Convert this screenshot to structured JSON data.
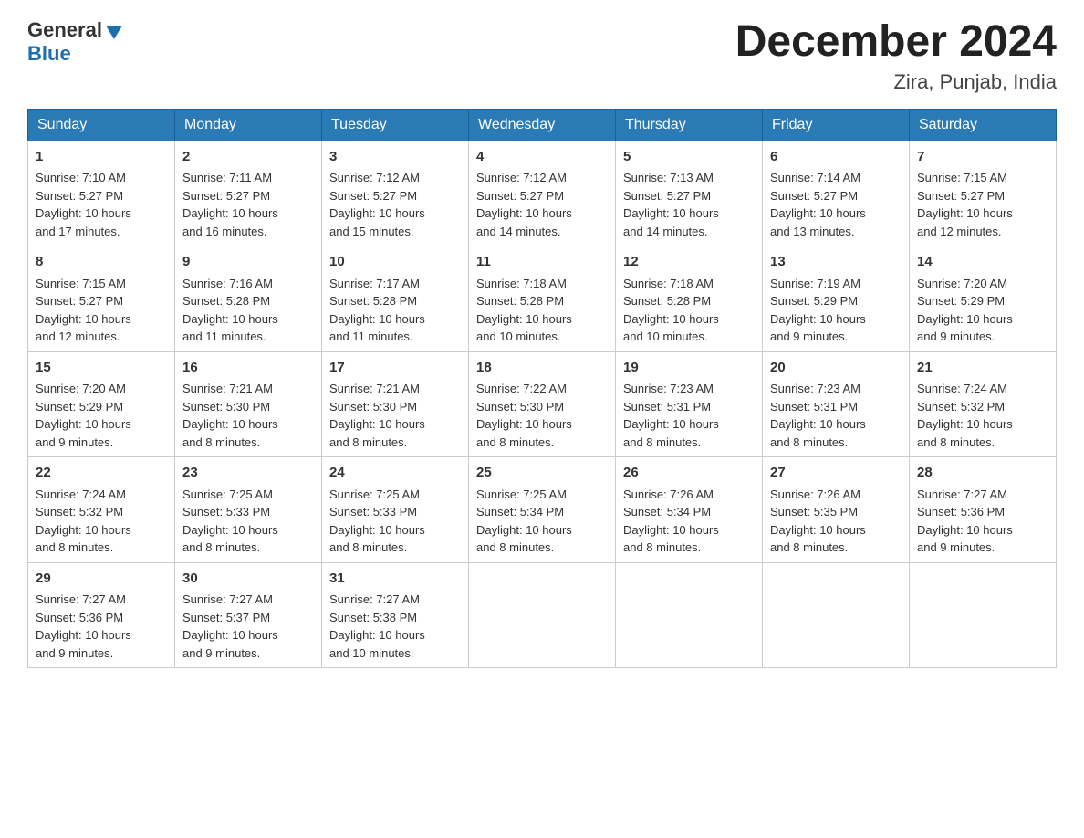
{
  "header": {
    "logo_general": "General",
    "logo_blue": "Blue",
    "month_title": "December 2024",
    "location": "Zira, Punjab, India"
  },
  "days_of_week": [
    "Sunday",
    "Monday",
    "Tuesday",
    "Wednesday",
    "Thursday",
    "Friday",
    "Saturday"
  ],
  "weeks": [
    [
      {
        "day": "1",
        "sunrise": "7:10 AM",
        "sunset": "5:27 PM",
        "daylight": "10 hours and 17 minutes."
      },
      {
        "day": "2",
        "sunrise": "7:11 AM",
        "sunset": "5:27 PM",
        "daylight": "10 hours and 16 minutes."
      },
      {
        "day": "3",
        "sunrise": "7:12 AM",
        "sunset": "5:27 PM",
        "daylight": "10 hours and 15 minutes."
      },
      {
        "day": "4",
        "sunrise": "7:12 AM",
        "sunset": "5:27 PM",
        "daylight": "10 hours and 14 minutes."
      },
      {
        "day": "5",
        "sunrise": "7:13 AM",
        "sunset": "5:27 PM",
        "daylight": "10 hours and 14 minutes."
      },
      {
        "day": "6",
        "sunrise": "7:14 AM",
        "sunset": "5:27 PM",
        "daylight": "10 hours and 13 minutes."
      },
      {
        "day": "7",
        "sunrise": "7:15 AM",
        "sunset": "5:27 PM",
        "daylight": "10 hours and 12 minutes."
      }
    ],
    [
      {
        "day": "8",
        "sunrise": "7:15 AM",
        "sunset": "5:27 PM",
        "daylight": "10 hours and 12 minutes."
      },
      {
        "day": "9",
        "sunrise": "7:16 AM",
        "sunset": "5:28 PM",
        "daylight": "10 hours and 11 minutes."
      },
      {
        "day": "10",
        "sunrise": "7:17 AM",
        "sunset": "5:28 PM",
        "daylight": "10 hours and 11 minutes."
      },
      {
        "day": "11",
        "sunrise": "7:18 AM",
        "sunset": "5:28 PM",
        "daylight": "10 hours and 10 minutes."
      },
      {
        "day": "12",
        "sunrise": "7:18 AM",
        "sunset": "5:28 PM",
        "daylight": "10 hours and 10 minutes."
      },
      {
        "day": "13",
        "sunrise": "7:19 AM",
        "sunset": "5:29 PM",
        "daylight": "10 hours and 9 minutes."
      },
      {
        "day": "14",
        "sunrise": "7:20 AM",
        "sunset": "5:29 PM",
        "daylight": "10 hours and 9 minutes."
      }
    ],
    [
      {
        "day": "15",
        "sunrise": "7:20 AM",
        "sunset": "5:29 PM",
        "daylight": "10 hours and 9 minutes."
      },
      {
        "day": "16",
        "sunrise": "7:21 AM",
        "sunset": "5:30 PM",
        "daylight": "10 hours and 8 minutes."
      },
      {
        "day": "17",
        "sunrise": "7:21 AM",
        "sunset": "5:30 PM",
        "daylight": "10 hours and 8 minutes."
      },
      {
        "day": "18",
        "sunrise": "7:22 AM",
        "sunset": "5:30 PM",
        "daylight": "10 hours and 8 minutes."
      },
      {
        "day": "19",
        "sunrise": "7:23 AM",
        "sunset": "5:31 PM",
        "daylight": "10 hours and 8 minutes."
      },
      {
        "day": "20",
        "sunrise": "7:23 AM",
        "sunset": "5:31 PM",
        "daylight": "10 hours and 8 minutes."
      },
      {
        "day": "21",
        "sunrise": "7:24 AM",
        "sunset": "5:32 PM",
        "daylight": "10 hours and 8 minutes."
      }
    ],
    [
      {
        "day": "22",
        "sunrise": "7:24 AM",
        "sunset": "5:32 PM",
        "daylight": "10 hours and 8 minutes."
      },
      {
        "day": "23",
        "sunrise": "7:25 AM",
        "sunset": "5:33 PM",
        "daylight": "10 hours and 8 minutes."
      },
      {
        "day": "24",
        "sunrise": "7:25 AM",
        "sunset": "5:33 PM",
        "daylight": "10 hours and 8 minutes."
      },
      {
        "day": "25",
        "sunrise": "7:25 AM",
        "sunset": "5:34 PM",
        "daylight": "10 hours and 8 minutes."
      },
      {
        "day": "26",
        "sunrise": "7:26 AM",
        "sunset": "5:34 PM",
        "daylight": "10 hours and 8 minutes."
      },
      {
        "day": "27",
        "sunrise": "7:26 AM",
        "sunset": "5:35 PM",
        "daylight": "10 hours and 8 minutes."
      },
      {
        "day": "28",
        "sunrise": "7:27 AM",
        "sunset": "5:36 PM",
        "daylight": "10 hours and 9 minutes."
      }
    ],
    [
      {
        "day": "29",
        "sunrise": "7:27 AM",
        "sunset": "5:36 PM",
        "daylight": "10 hours and 9 minutes."
      },
      {
        "day": "30",
        "sunrise": "7:27 AM",
        "sunset": "5:37 PM",
        "daylight": "10 hours and 9 minutes."
      },
      {
        "day": "31",
        "sunrise": "7:27 AM",
        "sunset": "5:38 PM",
        "daylight": "10 hours and 10 minutes."
      },
      null,
      null,
      null,
      null
    ]
  ],
  "labels": {
    "sunrise": "Sunrise:",
    "sunset": "Sunset:",
    "daylight": "Daylight:"
  }
}
